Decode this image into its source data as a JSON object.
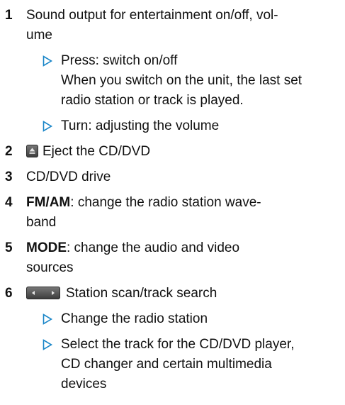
{
  "items": [
    {
      "number": "1",
      "text": "Sound output for entertainment on/off, volume",
      "subitems": [
        {
          "text": "Press: switch on/off\nWhen you switch on the unit, the last set radio station or track is played."
        },
        {
          "text": "Turn: adjusting the volume"
        }
      ]
    },
    {
      "number": "2",
      "text": "Eject the CD/DVD",
      "icon": "eject-button-icon"
    },
    {
      "number": "3",
      "text": "CD/DVD drive"
    },
    {
      "number": "4",
      "bold": "FM/AM",
      "text": ": change the radio station wave-band"
    },
    {
      "number": "5",
      "bold": "MODE",
      "text": ": change the audio and video sources"
    },
    {
      "number": "6",
      "text": "Station scan/track search",
      "icon": "seek-buttons-icon",
      "subitems": [
        {
          "text": "Change the radio station"
        },
        {
          "text": "Select the track for the CD/DVD player, CD changer and certain multimedia devices"
        }
      ]
    }
  ],
  "colors": {
    "accent_triangle": "#1a86c8",
    "button_icon": "#4a4a4a"
  }
}
